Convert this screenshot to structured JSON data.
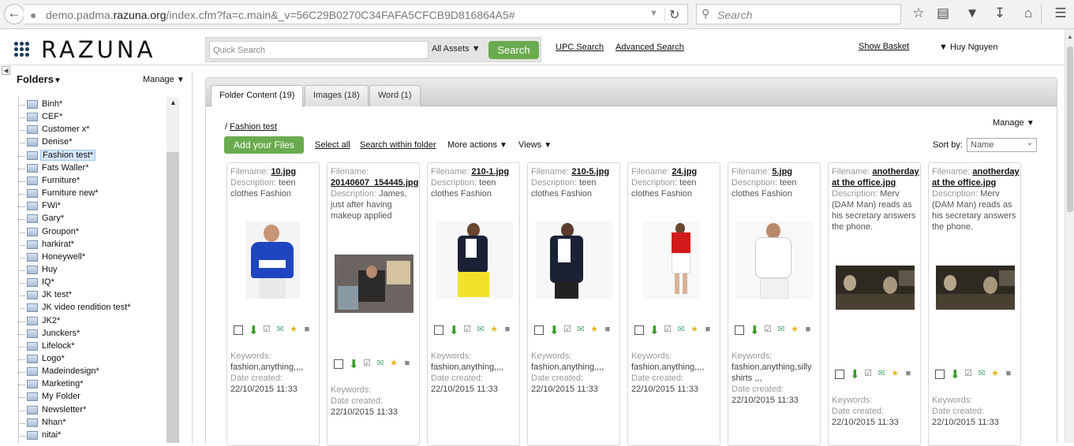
{
  "browser": {
    "url_prefix": "demo.padma.",
    "url_domain": "razuna.org",
    "url_suffix": "/index.cfm?fa=c.main&_v=56C29B0270C34FAFA5CFCB9D816864A5#",
    "search_placeholder": "Search",
    "icons": [
      "back-arrow-icon",
      "globe-icon",
      "reload-icon",
      "search-icon",
      "star-icon",
      "reading-list-icon",
      "pocket-icon",
      "download-icon",
      "home-icon",
      "menu-icon"
    ]
  },
  "header": {
    "brand": "RAZUNA",
    "quick_search_placeholder": "Quick Search",
    "asset_filter": "All Assets",
    "search_button": "Search",
    "upc_search": "UPC Search",
    "advanced_search": "Advanced Search",
    "show_basket": "Show Basket",
    "user": "Huy Nguyen"
  },
  "sidebar": {
    "title": "Folders",
    "manage": "Manage",
    "folders": [
      {
        "label": "Binh*"
      },
      {
        "label": "CEF*"
      },
      {
        "label": "Customer x*"
      },
      {
        "label": "Denise*"
      },
      {
        "label": "Fashion test*",
        "selected": true
      },
      {
        "label": "Fats Waller*"
      },
      {
        "label": "Furniture*"
      },
      {
        "label": "Furniture new*"
      },
      {
        "label": "FWi*"
      },
      {
        "label": "Gary*"
      },
      {
        "label": "Groupon*"
      },
      {
        "label": "harkirat*"
      },
      {
        "label": "Honeywell*"
      },
      {
        "label": "Huy"
      },
      {
        "label": "IQ*"
      },
      {
        "label": "JK test*"
      },
      {
        "label": "JK video rendition test*"
      },
      {
        "label": "JK2*"
      },
      {
        "label": "Junckers*"
      },
      {
        "label": "Lifelock*"
      },
      {
        "label": "Logo*"
      },
      {
        "label": "Madeindesign*"
      },
      {
        "label": "Marketing*"
      },
      {
        "label": "My Folder"
      },
      {
        "label": "Newsletter*"
      },
      {
        "label": "Nhan*"
      },
      {
        "label": "nitai*"
      }
    ]
  },
  "main": {
    "tabs": [
      {
        "label": "Folder Content (19)",
        "active": true
      },
      {
        "label": "Images (18)"
      },
      {
        "label": "Word (1)"
      }
    ],
    "breadcrumb_sep": "/",
    "breadcrumb": "Fashion test",
    "manage": "Manage",
    "add_files": "Add your Files",
    "select_all": "Select all",
    "search_within": "Search within folder",
    "more_actions": "More actions",
    "views": "Views",
    "sort_label": "Sort by:",
    "sort_value": "Name",
    "labels": {
      "filename": "Filename:",
      "description": "Description:",
      "keywords": "Keywords:",
      "date_created": "Date created:"
    },
    "assets": [
      {
        "filename": "10.jpg",
        "description": "teen clothes Fashion",
        "keywords": "fashion,anything,,,,",
        "date": "22/10/2015 11:33",
        "image": "person-blue-sweater"
      },
      {
        "filename": "20140607_154445.jpg",
        "description": "James, just after having makeup applied",
        "keywords": "",
        "date": "22/10/2015 11:33",
        "image": "office-photo"
      },
      {
        "filename": "210-1.jpg",
        "description": "teen clothes Fashion",
        "keywords": "fashion,anything,,,,",
        "date": "22/10/2015 11:33",
        "image": "woman-navy-blazer-yellow"
      },
      {
        "filename": "210-5.jpg",
        "description": "teen clothes Fashion",
        "keywords": "fashion,anything,,,,",
        "date": "22/10/2015 11:33",
        "image": "woman-navy-blazer"
      },
      {
        "filename": "24.jpg",
        "description": "teen clothes Fashion",
        "keywords": "fashion,anything,,,,",
        "date": "22/10/2015 11:33",
        "image": "woman-red-top"
      },
      {
        "filename": "5.jpg",
        "description": "teen clothes Fashion",
        "keywords": "fashion,anything,silly shirts ,,,",
        "date": "22/10/2015 11:33",
        "image": "man-white-polo"
      },
      {
        "filename": "anotherday at the office.jpg",
        "description": "Merv (DAM Man) reads as his secretary answers the phone.",
        "keywords": "",
        "date": "22/10/2015 11:33",
        "image": "office-dark-scene"
      },
      {
        "filename": "anotherday at the office.jpg",
        "description": "Merv (DAM Man) reads as his secretary answers the phone.",
        "keywords": "",
        "date": "22/10/2015 11:33",
        "image": "office-dark-scene"
      }
    ]
  },
  "colors": {
    "accent_green": "#6aab4f",
    "selected_folder": "#d5e8fb",
    "brand_dark": "#1a3a5c"
  }
}
